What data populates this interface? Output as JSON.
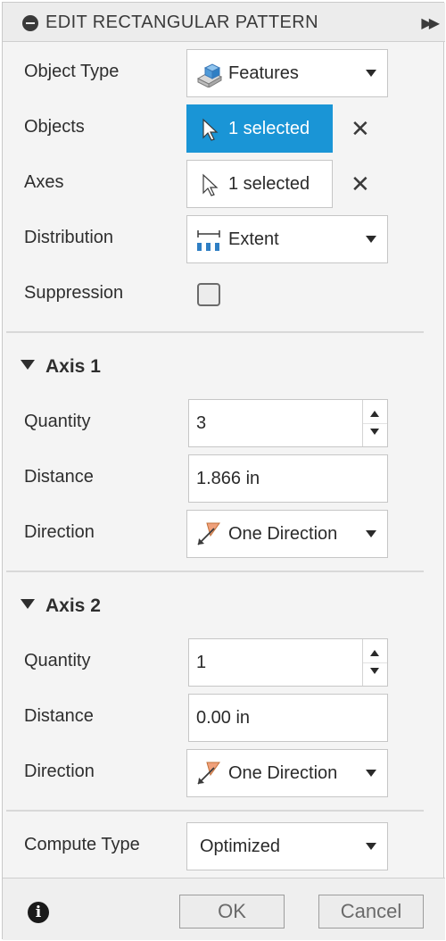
{
  "dialog": {
    "title": "EDIT RECTANGULAR PATTERN"
  },
  "rows": {
    "object_type": {
      "label": "Object Type",
      "value": "Features"
    },
    "objects": {
      "label": "Objects",
      "value": "1 selected"
    },
    "axes": {
      "label": "Axes",
      "value": "1 selected"
    },
    "distribution": {
      "label": "Distribution",
      "value": "Extent"
    },
    "suppression": {
      "label": "Suppression",
      "checked": false
    }
  },
  "axis1": {
    "header": "Axis 1",
    "quantity_label": "Quantity",
    "quantity": "3",
    "distance_label": "Distance",
    "distance": "1.866 in",
    "direction_label": "Direction",
    "direction": "One Direction"
  },
  "axis2": {
    "header": "Axis 2",
    "quantity_label": "Quantity",
    "quantity": "1",
    "distance_label": "Distance",
    "distance": "0.00 in",
    "direction_label": "Direction",
    "direction": "One Direction"
  },
  "compute": {
    "label": "Compute Type",
    "value": "Optimized"
  },
  "footer": {
    "ok_label": "OK",
    "cancel_label": "Cancel",
    "info_glyph": "i"
  },
  "colors": {
    "selected_bg": "#1a95d6",
    "panel_bg": "#f4f4f4",
    "direction_flag": "#f0a07a"
  }
}
